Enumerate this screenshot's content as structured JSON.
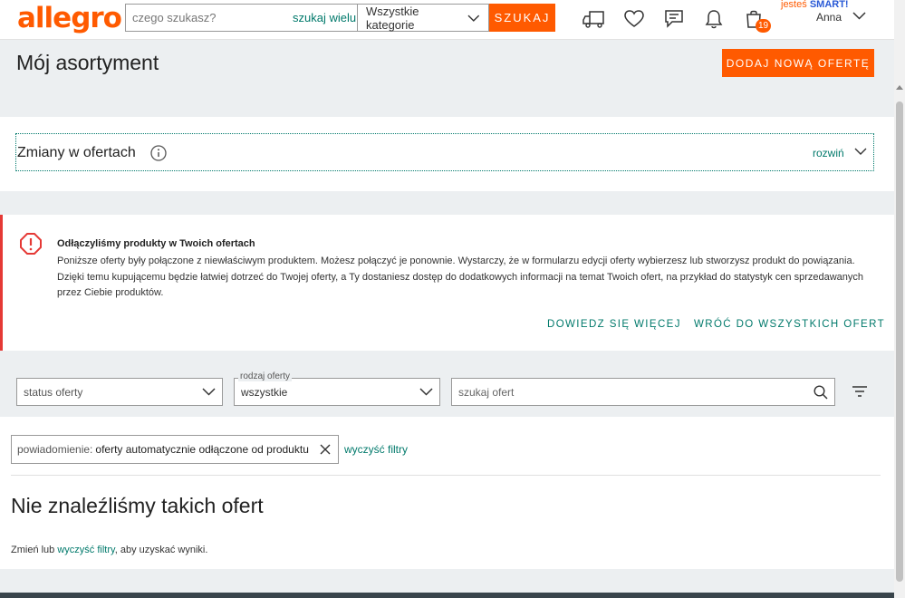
{
  "header": {
    "logo": "allegro",
    "search_placeholder": "czego szukasz?",
    "search_many": "szukaj wielu",
    "category": "Wszystkie kategorie",
    "search_button": "SZUKAJ",
    "cart_count": "19",
    "smart_prefix": "jesteś",
    "smart_label": "SMART!",
    "user_name": "Anna"
  },
  "page": {
    "title": "Mój asortyment",
    "add_offer": "DODAJ NOWĄ OFERTĘ"
  },
  "changes": {
    "title": "Zmiany w ofertach",
    "expand": "rozwiń"
  },
  "alert": {
    "title": "Odłączyliśmy produkty w Twoich ofertach",
    "text": "Poniższe oferty były połączone z niewłaściwym produktem. Możesz połączyć je ponownie. Wystarczy, że w formularzu edycji oferty wybierzesz lub stworzysz produkt do powiązania. Dzięki temu kupującemu będzie łatwiej dotrzeć do Twojej oferty, a Ty dostaniesz dostęp do dodatkowych informacji na temat Twoich ofert, na przykład do statystyk cen sprzedawanych przez Ciebie produktów.",
    "learn_more": "DOWIEDZ SIĘ WIĘCEJ",
    "back_all": "WRÓĆ DO WSZYSTKICH OFERT"
  },
  "filters": {
    "status": "status oferty",
    "type_legend": "rodzaj oferty",
    "type_value": "wszystkie",
    "search_placeholder": "szukaj ofert"
  },
  "chip": {
    "label": "powiadomienie:",
    "value": "oferty automatycznie odłączone od produktu",
    "clear": "wyczyść filtry"
  },
  "results": {
    "title": "Nie znaleźliśmy takich ofert",
    "text_before": "Zmień lub",
    "text_link": "wyczyść filtry",
    "text_after": ", aby uzyskać wyniki."
  },
  "colors": {
    "brand": "#ff5a00",
    "link": "#00796b",
    "alert": "#e53935"
  }
}
